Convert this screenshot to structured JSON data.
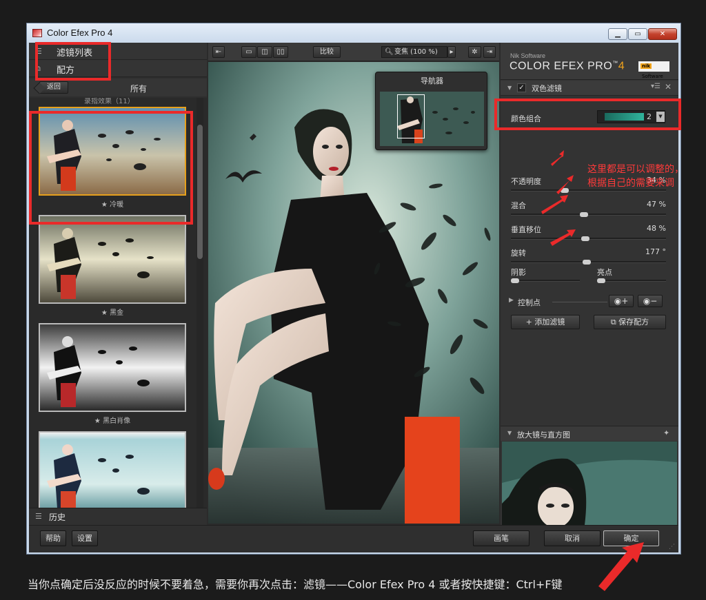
{
  "window": {
    "title": "Color Efex Pro 4"
  },
  "left_panel": {
    "filter_list_label": "滤镜列表",
    "recipes_label": "配方",
    "back_label": "返回",
    "category_label": "所有",
    "group_title": "录指效果（11）",
    "thumbnails": [
      {
        "caption": "★ 冷暖"
      },
      {
        "caption": "★ 黑金"
      },
      {
        "caption": "★ 黑白肖像"
      },
      {
        "caption": ""
      }
    ],
    "history_label": "历史"
  },
  "toolbar": {
    "compare_label": "比较",
    "zoom_label": "变焦 (100 %)"
  },
  "navigator": {
    "title": "导航器"
  },
  "right_panel": {
    "brand_small": "Nik Software",
    "brand_name": "COLOR EFEX PRO",
    "brand_tm": "™",
    "brand_version": "4",
    "nik_logo_mark": "nik",
    "nik_logo_text": "Software",
    "filter_name": "双色滤镜",
    "preset_label": "颜色组合",
    "preset_value": "2",
    "sliders": [
      {
        "label": "不透明度",
        "value": "34 %",
        "level": 0.34
      },
      {
        "label": "混合",
        "value": "47 %",
        "level": 0.47
      },
      {
        "label": "垂直移位",
        "value": "48 %",
        "level": 0.48
      },
      {
        "label": "旋转",
        "value": "177 °",
        "level": 0.49
      }
    ],
    "shadow_label": "阴影",
    "highlight_label": "亮点",
    "control_points_label": "控制点",
    "add_filter_label": "添加滤镜",
    "save_recipe_label": "保存配方",
    "loupe_label": "放大镜与直方图"
  },
  "bottom_bar": {
    "help_label": "帮助",
    "settings_label": "设置",
    "brush_label": "画笔",
    "cancel_label": "取消",
    "ok_label": "确定"
  },
  "annotation": {
    "note": "这里都是可以调整的，根据自己的需要来调",
    "caption": "当你点确定后没反应的时候不要着急，需要你再次点击：滤镜——Color Efex Pro 4   或者按快捷键：Ctrl+F键"
  },
  "colors": {
    "accent_orange": "#f0a21c",
    "annotation_red": "#ea2a2a",
    "duotone_teal": "#30b49c"
  }
}
